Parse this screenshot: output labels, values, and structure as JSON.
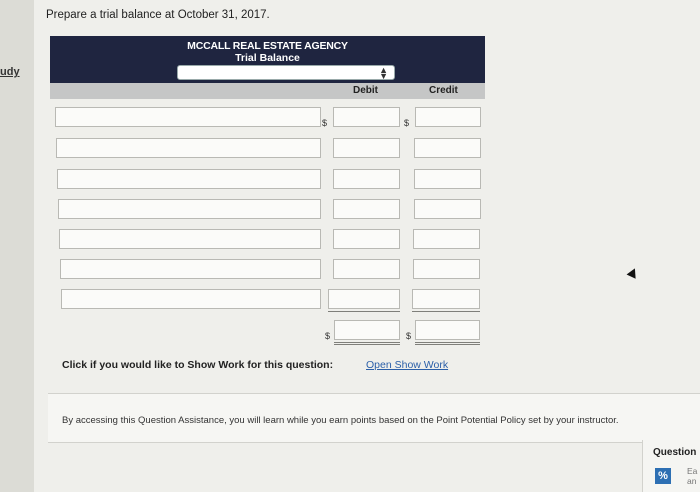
{
  "sidebar": {
    "label": "udy"
  },
  "prompt": "Prepare a trial balance at October 31, 2017.",
  "trial_balance": {
    "company": "MCCALL REAL ESTATE AGENCY",
    "title": "Trial Balance",
    "date_select_value": "",
    "columns": {
      "debit": "Debit",
      "credit": "Credit"
    },
    "currency_symbol": "$",
    "rows": [
      {
        "account": "",
        "debit": "",
        "credit": ""
      },
      {
        "account": "",
        "debit": "",
        "credit": ""
      },
      {
        "account": "",
        "debit": "",
        "credit": ""
      },
      {
        "account": "",
        "debit": "",
        "credit": ""
      },
      {
        "account": "",
        "debit": "",
        "credit": ""
      },
      {
        "account": "",
        "debit": "",
        "credit": ""
      },
      {
        "account": "",
        "debit": "",
        "credit": ""
      }
    ],
    "totals": {
      "debit": "",
      "credit": ""
    }
  },
  "show_work": {
    "prompt": "Click if you would like to Show Work for this question:",
    "link": "Open Show Work"
  },
  "assistance": {
    "text": "By accessing this Question Assistance, you will learn while you earn points based on the Point Potential Policy set by your instructor."
  },
  "question_panel": {
    "label": "Question",
    "icon": "percent-icon",
    "text_line1": "Ea",
    "text_line2": "an"
  }
}
